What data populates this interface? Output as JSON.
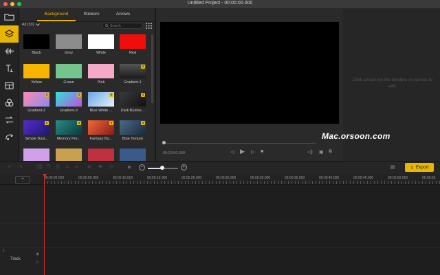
{
  "window": {
    "title": "Untitled Project - 00:00:00.000"
  },
  "colors": {
    "accent": "#e8b500",
    "playhead": "#d23030",
    "canvas": "#000000"
  },
  "sidebar": {
    "items": [
      {
        "icon": "folder-icon"
      },
      {
        "icon": "layers-icon",
        "active": true
      },
      {
        "icon": "audio-wave-icon"
      },
      {
        "icon": "text-icon"
      },
      {
        "icon": "overlay-icon"
      },
      {
        "icon": "filters-icon"
      },
      {
        "icon": "transitions-icon"
      },
      {
        "icon": "motion-icon"
      }
    ]
  },
  "library": {
    "tabs": [
      "Background",
      "Stickers",
      "Arrows"
    ],
    "active_tab": "Background",
    "filter": "All (33)",
    "search_placeholder": "Search",
    "items": [
      {
        "label": "Black",
        "color": "#000000",
        "premium": false
      },
      {
        "label": "Grey",
        "color": "#8c8c8c",
        "premium": false
      },
      {
        "label": "White",
        "color": "#ffffff",
        "premium": false
      },
      {
        "label": "Red",
        "color": "#f20d0d",
        "premium": false
      },
      {
        "label": "Yellow",
        "color": "#f7b500",
        "premium": false
      },
      {
        "label": "Green",
        "color": "#74c48e",
        "premium": false
      },
      {
        "label": "Pink",
        "color": "#f5a8c8",
        "premium": false
      },
      {
        "label": "Gradient-1",
        "color": "#3a3a3a",
        "premium": true
      },
      {
        "label": "Gradient-2",
        "color": "#9b7bd8",
        "premium": true
      },
      {
        "label": "Gradient-3",
        "color": "#3ad0d8",
        "premium": true
      },
      {
        "label": "Blue White ...",
        "color": "#7fb8e8",
        "premium": true
      },
      {
        "label": "Dark Busine...",
        "color": "#2a2a2a",
        "premium": true
      },
      {
        "label": "Simple Busi...",
        "color": "#3a2a8a",
        "premium": true
      },
      {
        "label": "Memory Pre...",
        "color": "#1f6a6a",
        "premium": true
      },
      {
        "label": "Fantasy Bu...",
        "color": "#d85a3a",
        "premium": true
      },
      {
        "label": "Blue Texture",
        "color": "#3a5a7a",
        "premium": true
      }
    ]
  },
  "player": {
    "timecode": "00:00:00.000"
  },
  "properties": {
    "hint": "Click a track on the timeline or canvas to edit."
  },
  "watermark": "Mac.orsoon.com",
  "toolbar": {
    "export_label": "Export"
  },
  "ruler": {
    "labels": [
      "00:00:00.000",
      "00:00:05.000",
      "00:00:10.000",
      "00:00:15.000",
      "00:00:20.000",
      "00:00:25.000",
      "00:00:30.000",
      "00:00:35.000",
      "00:00:40.000",
      "00:00:45.000",
      "00:00:50.000",
      "00:00:55"
    ]
  },
  "timeline": {
    "track_label": "Track",
    "track_number": "1"
  }
}
